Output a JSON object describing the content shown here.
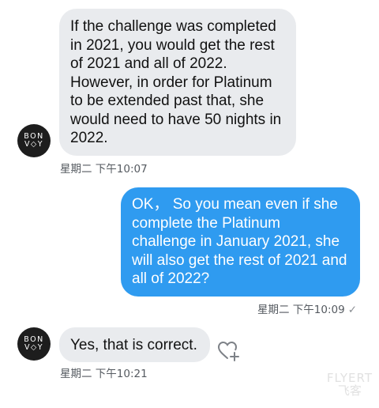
{
  "messages": {
    "m1": {
      "sender": "BONVOY",
      "text": "If the challenge was completed\nin 2021, you would get the rest\nof 2021 and all of 2022.\nHowever, in order for Platinum\nto be extended past that, she\nwould need to have 50 nights in\n2022.",
      "time": "星期二 下午10:07"
    },
    "m2": {
      "text": "OK，  So you mean even if she\ncomplete the Platinum\nchallenge in January 2021,  she\nwill also get the rest of 2021 and\nall of 2022?",
      "time": "星期二 下午10:09",
      "status_icon": "check-icon",
      "check": "✓"
    },
    "m3": {
      "sender": "BONVOY",
      "text": "Yes, that is correct.",
      "time": "星期二 下午10:21",
      "reaction_icon": "heart-plus-icon"
    }
  },
  "avatar": {
    "line1": "BON",
    "line2": "V◇Y"
  },
  "watermark": {
    "line1": "FLYERT",
    "line2": "飞客"
  },
  "colors": {
    "incoming": "#e9ebee",
    "outgoing": "#2f9bf0",
    "avatar": "#1d1d1d"
  }
}
